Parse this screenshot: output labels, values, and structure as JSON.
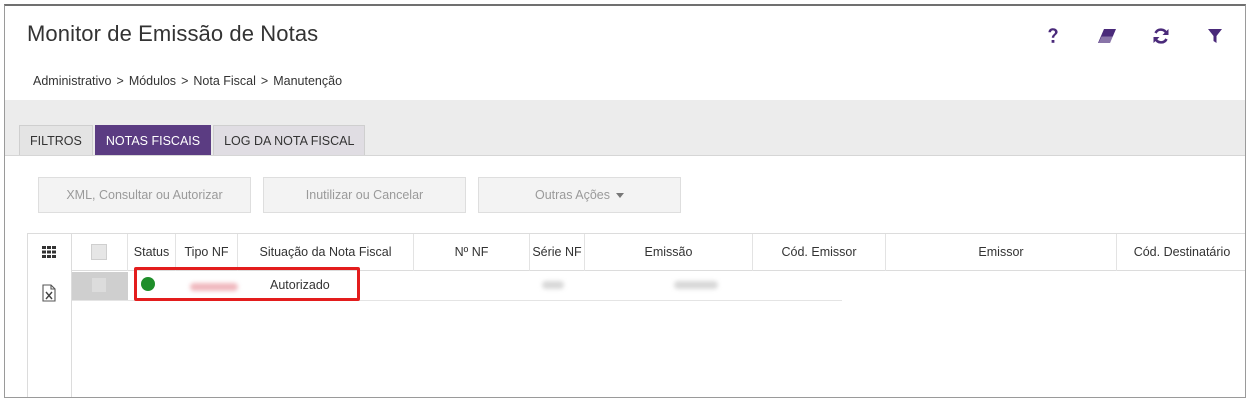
{
  "header": {
    "title": "Monitor de Emissão de Notas",
    "icons": [
      "help-icon",
      "eraser-icon",
      "refresh-icon",
      "filter-icon"
    ],
    "accent_color": "#4a2a7a"
  },
  "breadcrumb": [
    "Administrativo",
    "Módulos",
    "Nota Fiscal",
    "Manutenção"
  ],
  "breadcrumb_sep": ">",
  "tabs": [
    {
      "label": "FILTROS",
      "active": false
    },
    {
      "label": "NOTAS FISCAIS",
      "active": true
    },
    {
      "label": "LOG DA NOTA FISCAL",
      "active": false
    }
  ],
  "actions": {
    "xml": "XML, Consultar ou Autorizar",
    "inutilizar": "Inutilizar ou Cancelar",
    "outras": "Outras Ações"
  },
  "table": {
    "columns": [
      "Status",
      "Tipo NF",
      "Situação da Nota Fiscal",
      "Nº NF",
      "Série NF",
      "Emissão",
      "Cód. Emissor",
      "Emissor",
      "Cód. Destinatário"
    ],
    "rows": [
      {
        "status_color": "#1e8e2a",
        "situacao": "Autorizado"
      }
    ]
  },
  "colors": {
    "tab_active": "#5b3c82",
    "highlight": "#e31d1d"
  }
}
